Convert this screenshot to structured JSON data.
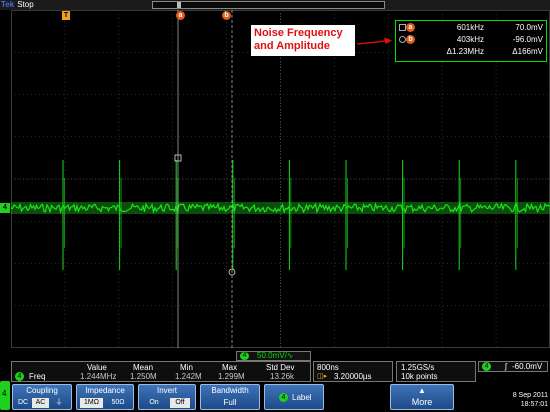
{
  "topbar": {
    "brand": "Tek",
    "status": "Stop"
  },
  "markers": {
    "trigger": "T",
    "cursor_a": "a",
    "cursor_b": "b",
    "channel": "4"
  },
  "annotation": {
    "line1": "Noise Frequency",
    "line2": "and Amplitude"
  },
  "cursor_readout": {
    "rows": [
      {
        "badge": "a",
        "v1": "601kHz",
        "v2": "70.0mV"
      },
      {
        "badge": "b",
        "v1": "403kHz",
        "v2": "-96.0mV"
      },
      {
        "badge": "",
        "v1": "Δ1.23MHz",
        "v2": "Δ166mV"
      }
    ]
  },
  "vertical_scale": {
    "channel": "4",
    "value": "50.0mV/∿"
  },
  "measurement": {
    "headers": [
      "Value",
      "Mean",
      "Min",
      "Max",
      "Std Dev"
    ],
    "row": {
      "channel": "4",
      "name": "Freq",
      "values": [
        "1.244MHz",
        "1.250M",
        "1.242M",
        "1.299M",
        "13.26k"
      ]
    }
  },
  "horizontal": {
    "scale": "800ns",
    "delay": "3.20000µs"
  },
  "sampling": {
    "rate": "1.25GS/s",
    "points": "10k points"
  },
  "trigger": {
    "channel": "4",
    "level": "-60.0mV"
  },
  "menu": {
    "coupling": {
      "label": "Coupling",
      "options": [
        "DC",
        "AC",
        "⏚"
      ],
      "selected": "AC"
    },
    "impedance": {
      "label": "Impedance",
      "options": [
        "1MΩ",
        "50Ω"
      ],
      "selected": "1MΩ"
    },
    "invert": {
      "label": "Invert",
      "options": [
        "On",
        "Off"
      ],
      "selected": "Off"
    },
    "bandwidth": {
      "label": "Bandwidth",
      "value": "Full"
    },
    "label_btn": {
      "channel": "4",
      "label": "Label"
    },
    "more": {
      "label": "More"
    },
    "channel_tab": "4"
  },
  "datetime": {
    "date": "8 Sep 2011",
    "time": "18:57:01"
  },
  "colors": {
    "trace": "#1fe01f",
    "grid": "#4a4a4a",
    "accent_blue": "#2f66b0",
    "cursor_orange": "#e35a1a",
    "annotation_red": "#e11010"
  }
}
